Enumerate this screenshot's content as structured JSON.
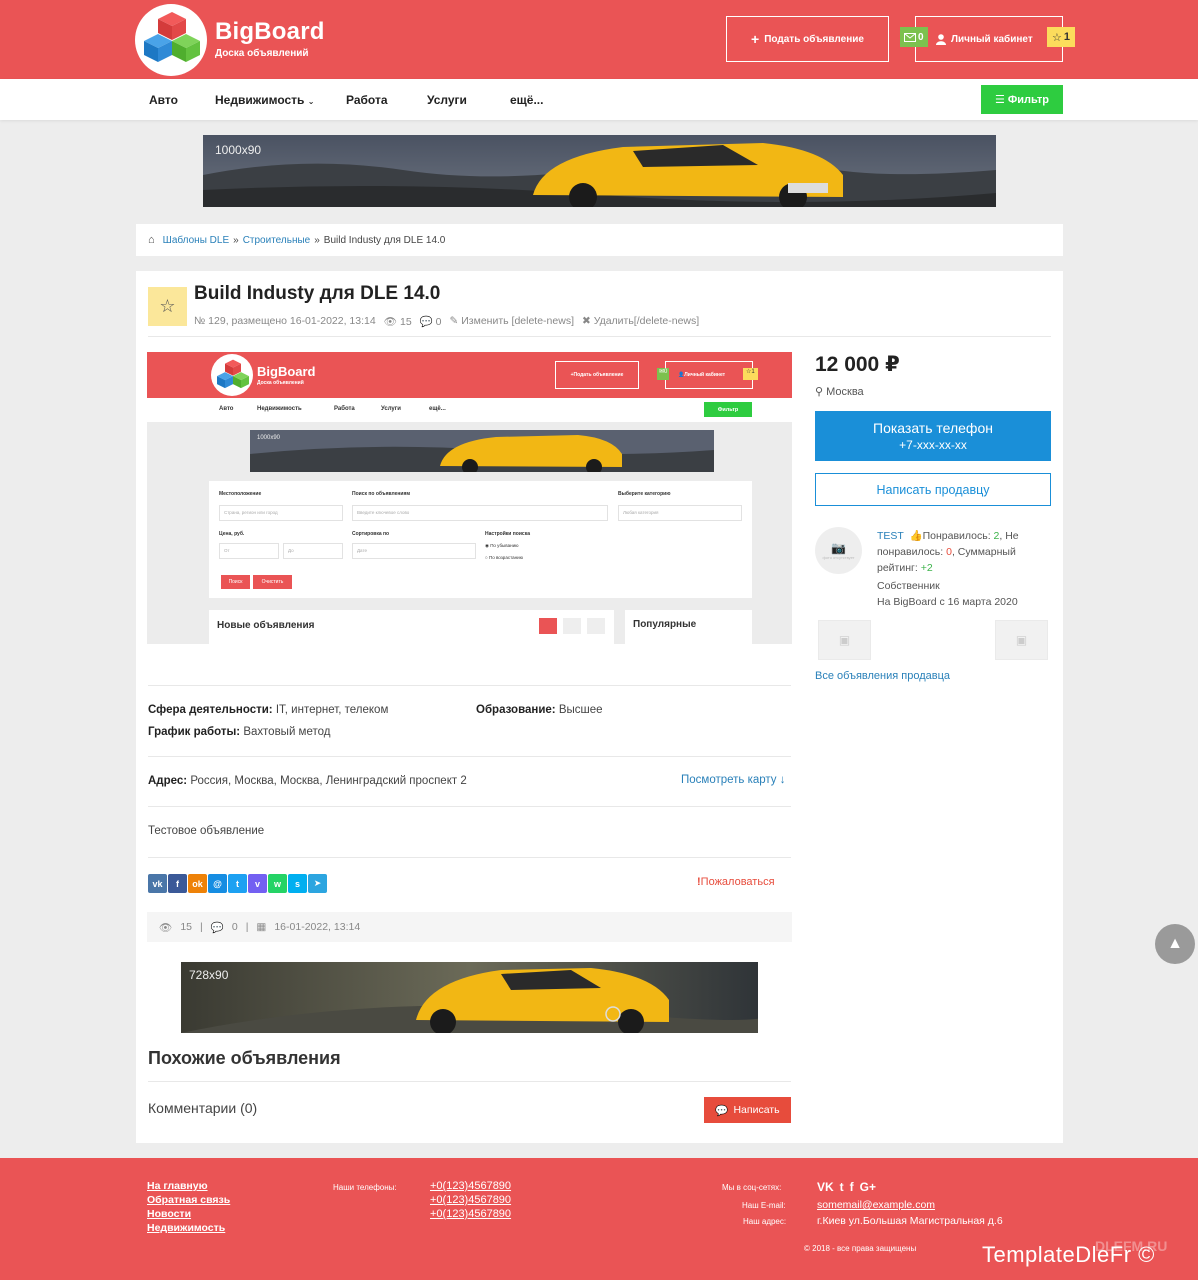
{
  "header": {
    "logo_title": "BigBoard",
    "logo_subtitle": "Доска объявлений",
    "add_button": "Подать объявление",
    "mail_count": "0",
    "cabinet": "Личный кабинет",
    "fav_count": "1"
  },
  "nav": {
    "items": [
      "Авто",
      "Недвижимость",
      "Работа",
      "Услуги",
      "ещё..."
    ],
    "filter": "Фильтр"
  },
  "banners": {
    "top": "1000x90",
    "bottom": "728x90"
  },
  "breadcrumb": {
    "home": "Шаблоны DLE",
    "sep": "»",
    "category": "Строительные",
    "current": "Build Industy для DLE 14.0"
  },
  "ad": {
    "title": "Build Industy для DLE 14.0",
    "meta_id": "№ 129, размещено 16-01-2022, 13:14",
    "views": "15",
    "comments": "0",
    "edit": "Изменить [delete-news]",
    "delete": "Удалить[/delete-news]",
    "price": "12 000 ₽",
    "city": "Москва",
    "show_phone": "Показать телефон",
    "phone_mask": "+7-xxx-xx-xx",
    "write_seller": "Написать продавцу",
    "sphere_label": "Сфера деятельности:",
    "sphere_value": "IT, интернет, телеком",
    "education_label": "Образование:",
    "education_value": "Высшее",
    "schedule_label": "График работы:",
    "schedule_value": "Вахтовый метод",
    "address_label": "Адрес:",
    "address_value": "Россия, Москва, Москва, Ленинградский проспект 2",
    "map_link": "Посмотреть карту ↓",
    "description": "Тестовое объявление",
    "complain": "Пожаловаться",
    "date": "16-01-2022, 13:14",
    "similar": "Похожие объявления",
    "comments_title": "Комментарии (0)",
    "write_comment": "Написать"
  },
  "seller": {
    "name": "TEST",
    "liked_label": "Понравилось:",
    "liked": "2",
    "disliked_label": "Не понравилось:",
    "disliked": "0",
    "rating_label": "Суммарный рейтинг:",
    "rating": "+2",
    "type": "Собственник",
    "since": "На BigBoard с 16 марта 2020",
    "avatar_text": "фото отсутствует",
    "all_ads": "Все объявления продавца"
  },
  "preview": {
    "logo_title": "BigBoard",
    "logo_subtitle": "Доска объявлений",
    "add_button": "Подать объявление",
    "mail_count": "0",
    "cabinet": "Личный кабинет",
    "fav_count": "1",
    "nav": [
      "Авто",
      "Недвижимость",
      "Работа",
      "Услуги",
      "ещё..."
    ],
    "filter": "Фильтр",
    "banner": "1000x90",
    "location_label": "Местоположение",
    "location_placeholder": "Страна, регион или город",
    "search_label": "Поиск по объявлениям",
    "search_placeholder": "Введите ключевое слово",
    "category_label": "Выберите категорию",
    "category_value": "Любая категория",
    "price_label": "Цена, руб.",
    "price_from": "От",
    "price_to": "До",
    "sort_label": "Сортировка по",
    "sort_value": "Дате",
    "settings_label": "Настройки поиска",
    "desc_option": "По убыванию",
    "asc_option": "По возрастанию",
    "search_btn": "Поиск",
    "clear_btn": "Очистить",
    "new_ads": "Новые объявления",
    "popular": "Популярные"
  },
  "footer": {
    "links": [
      "На главную",
      "Обратная связь",
      "Новости",
      "Недвижимость"
    ],
    "phones_label": "Наши телефоны:",
    "phones": [
      "+0(123)4567890",
      "+0(123)4567890",
      "+0(123)4567890"
    ],
    "social_label": "Мы в соц-сетях:",
    "social": [
      "VK",
      "t",
      "f",
      "G+"
    ],
    "email_label": "Наш E-mail:",
    "email": "somemail@example.com",
    "address_label": "Наш адрес:",
    "address": "г.Киев ул.Большая Магистральная д.6",
    "copyright": "© 2018 - все права защищены",
    "watermark": "TemplateDleFr ©",
    "watermark_sub": "DLEFM.RU"
  },
  "colors": {
    "brand_red": "#ea5455",
    "accent_blue": "#1a8fd8",
    "filter_green": "#2ecc40",
    "fav_yellow": "#fcdc5c"
  }
}
